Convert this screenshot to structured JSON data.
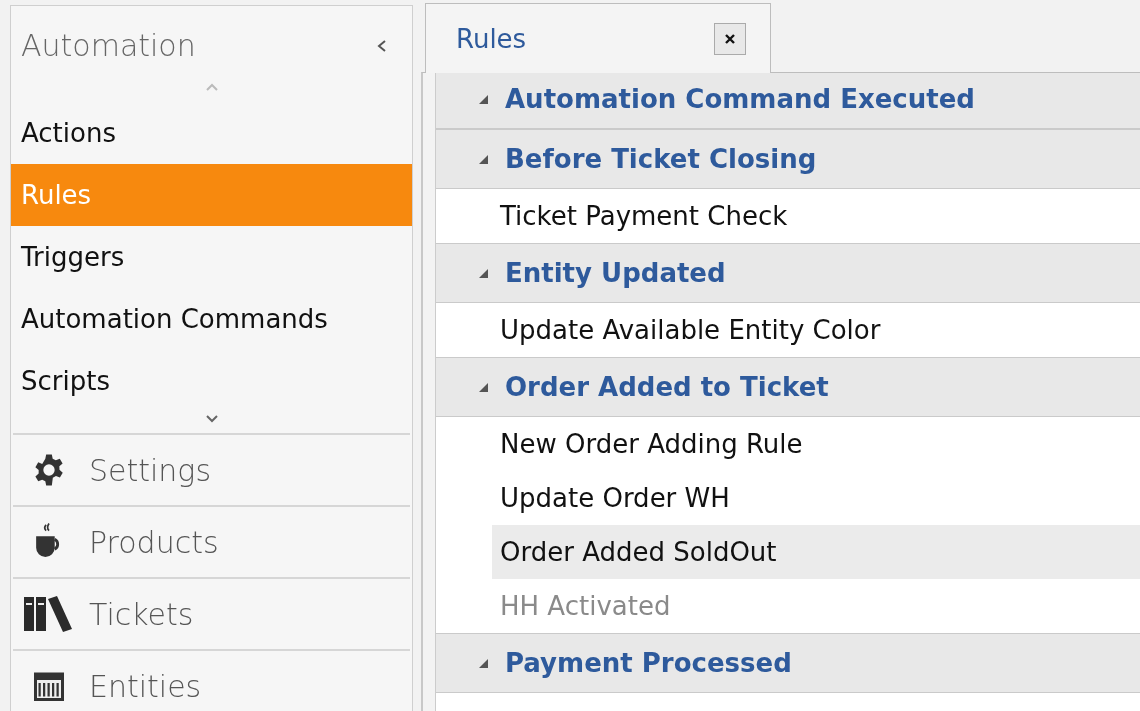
{
  "sidebar": {
    "title": "Automation",
    "items": [
      {
        "label": "Actions",
        "selected": false
      },
      {
        "label": "Rules",
        "selected": true
      },
      {
        "label": "Triggers",
        "selected": false
      },
      {
        "label": "Automation Commands",
        "selected": false
      },
      {
        "label": "Scripts",
        "selected": false
      }
    ],
    "sections": [
      {
        "label": "Settings",
        "kind": "gear"
      },
      {
        "label": "Products",
        "kind": "cup"
      },
      {
        "label": "Tickets",
        "kind": "books"
      },
      {
        "label": "Entities",
        "kind": "calendar"
      }
    ]
  },
  "tabs": [
    {
      "label": "Rules",
      "selected": true
    }
  ],
  "rule_groups": [
    {
      "title": "Automation Command Executed",
      "expanded": true
    },
    {
      "title": "Before Ticket Closing",
      "expanded": true,
      "rules": [
        {
          "name": "Ticket Payment Check",
          "selected": false,
          "disabled": false
        }
      ]
    },
    {
      "title": "Entity Updated",
      "expanded": true,
      "rules": [
        {
          "name": "Update Available Entity Color",
          "selected": false,
          "disabled": false
        }
      ]
    },
    {
      "title": "Order Added to Ticket",
      "expanded": true,
      "rules": [
        {
          "name": "New Order Adding Rule",
          "selected": false,
          "disabled": false
        },
        {
          "name": "Update Order WH",
          "selected": false,
          "disabled": false
        },
        {
          "name": "Order Added SoldOut",
          "selected": true,
          "disabled": false
        },
        {
          "name": "HH Activated",
          "selected": false,
          "disabled": true
        }
      ]
    },
    {
      "title": "Payment Processed",
      "expanded": true
    }
  ]
}
